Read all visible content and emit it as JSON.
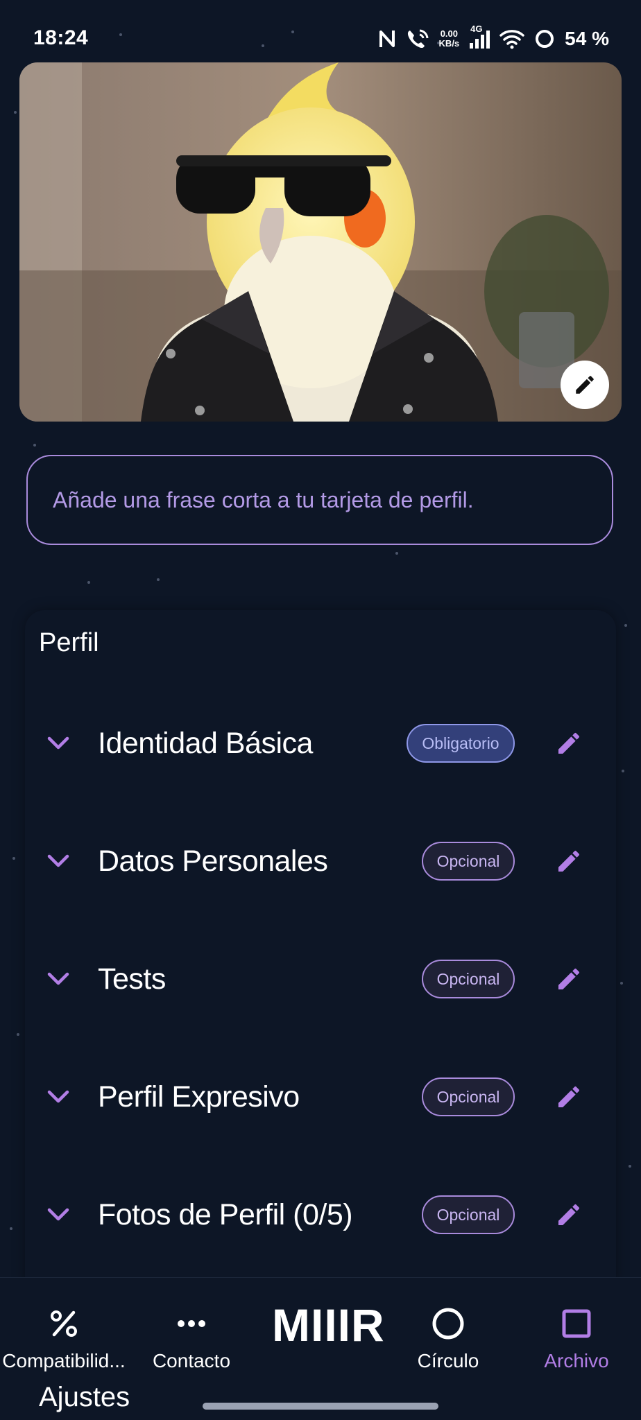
{
  "status_bar": {
    "time": "18:24",
    "net_speed_value": "0.00",
    "net_speed_unit": "KB/s",
    "network": "4G",
    "battery": "54 %",
    "icons": [
      "nfc-icon",
      "wifi-calling-icon",
      "signal-icon",
      "wifi-icon",
      "battery-ring-icon"
    ]
  },
  "hero": {
    "image": "cockatiel-with-sunglasses-and-leather-vest",
    "edit_icon": "pencil-icon"
  },
  "phrase": {
    "placeholder": "Añade una frase corta a tu tarjeta de perfil."
  },
  "profile": {
    "title": "Perfil",
    "sections": [
      {
        "label": "Identidad Básica",
        "badge": "Obligatorio",
        "badge_type": "required"
      },
      {
        "label": "Datos Personales",
        "badge": "Opcional",
        "badge_type": "optional"
      },
      {
        "label": "Tests",
        "badge": "Opcional",
        "badge_type": "optional"
      },
      {
        "label": "Perfil Expresivo",
        "badge": "Opcional",
        "badge_type": "optional"
      },
      {
        "label": "Fotos de Perfil (0/5)",
        "badge": "Opcional",
        "badge_type": "optional"
      }
    ]
  },
  "nav": {
    "brand": "MIIIR",
    "items": [
      {
        "label": "Compatibilid...",
        "icon": "percent-icon"
      },
      {
        "label": "Contacto",
        "icon": "more-dots-icon"
      },
      {
        "label": "Círculo",
        "icon": "circle-icon"
      },
      {
        "label": "Archivo",
        "icon": "square-icon"
      }
    ],
    "settings": "Ajustes"
  },
  "colors": {
    "background": "#0d1626",
    "accent": "#b27ee6",
    "border": "#a98bdc"
  }
}
